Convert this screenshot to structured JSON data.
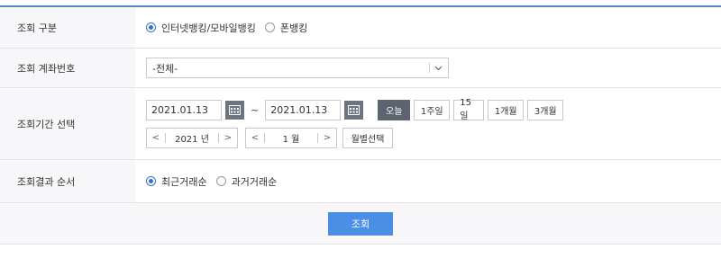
{
  "rows": {
    "type": {
      "label": "조회 구분",
      "options": [
        {
          "label": "인터넷뱅킹/모바일뱅킹",
          "selected": true
        },
        {
          "label": "폰뱅킹",
          "selected": false
        }
      ]
    },
    "account": {
      "label": "조회 계좌번호",
      "select_value": "-전체-",
      "chevron_icon": "chevron-down-icon"
    },
    "period": {
      "label": "조회기간 선택",
      "start_date": "2021.01.13",
      "end_date": "2021.01.13",
      "separator": "~",
      "quick_buttons": [
        "오늘",
        "1주일",
        "15일",
        "1개월",
        "3개월"
      ],
      "active_quick": "오늘",
      "year": "2021 년",
      "month": "1 월",
      "prev": "<",
      "next": ">",
      "month_select": "월별선택"
    },
    "order": {
      "label": "조회결과 순서",
      "options": [
        {
          "label": "최근거래순",
          "selected": true
        },
        {
          "label": "과거거래순",
          "selected": false
        }
      ]
    }
  },
  "submit_label": "조회",
  "colors": {
    "accent_line": "#5a86c5",
    "primary_button": "#4a8ee6",
    "active_button": "#5d6470"
  }
}
